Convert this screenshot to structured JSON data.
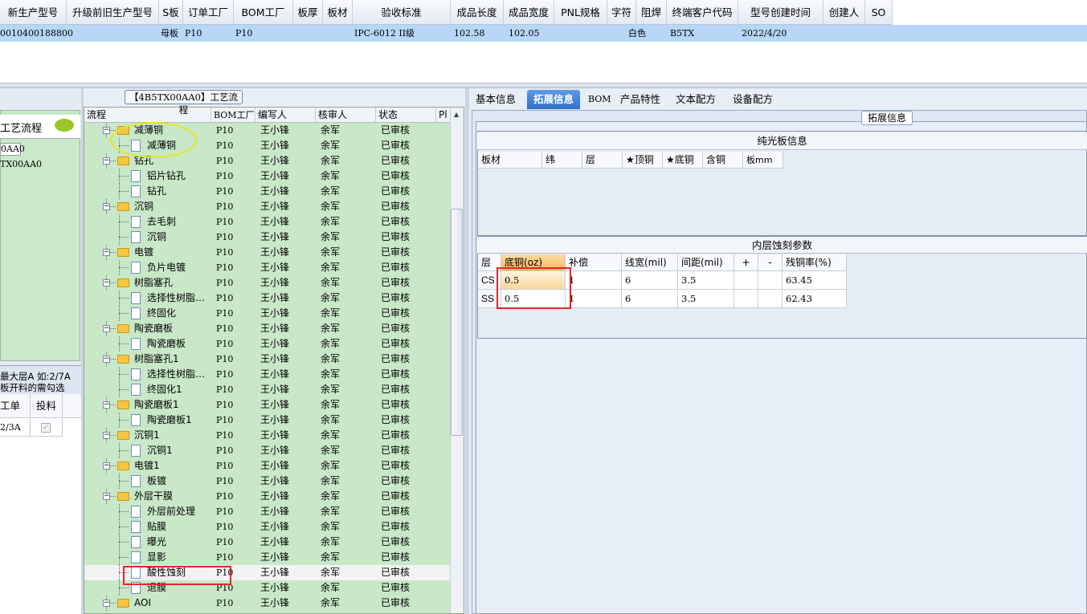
{
  "top_grid": {
    "columns": [
      "新生产型号",
      "升级前旧生产型号",
      "S板",
      "订单工厂",
      "BOM工厂",
      "板厚",
      "板材",
      "验收标准",
      "成品长度",
      "成品宽度",
      "PNL规格",
      "字符",
      "阻焊",
      "终端客户代码",
      "型号创建时间",
      "创建人",
      "SO"
    ],
    "row": {
      "new_model": "0010400188800",
      "s_board": "母板",
      "order_factory": "P10",
      "bom_factory": "P10",
      "standard": "IPC-6012 II级",
      "length": "102.58",
      "width": "102.05",
      "char_color": "白色",
      "customer_code": "B5TX",
      "created": "2022/4/20"
    }
  },
  "left_panel": {
    "title": "工艺流程",
    "item1": "0AA0",
    "item2": "TX00AA0",
    "note1": "最大层A 如:2/7A",
    "note2": "板开料的需勾选",
    "col_workorder": "工单",
    "col_feed": "投料",
    "row_value": "2/3A"
  },
  "middle_panel": {
    "title": "【4B5TX00AA0】工艺流程",
    "headers": [
      "流程",
      "BOM工厂",
      "编写人",
      "核审人",
      "状态",
      "Pl"
    ],
    "rows": [
      {
        "name": "减薄铜",
        "level": 0,
        "factory": "P10",
        "writer": "王小锋",
        "reviewer": "余军",
        "status": "已审核"
      },
      {
        "name": "减薄铜",
        "level": 1,
        "factory": "P10",
        "writer": "王小锋",
        "reviewer": "余军",
        "status": "已审核"
      },
      {
        "name": "钻孔",
        "level": 0,
        "factory": "P10",
        "writer": "王小锋",
        "reviewer": "余军",
        "status": "已审核"
      },
      {
        "name": "铝片钻孔",
        "level": 1,
        "factory": "P10",
        "writer": "王小锋",
        "reviewer": "余军",
        "status": "已审核"
      },
      {
        "name": "钻孔",
        "level": 1,
        "factory": "P10",
        "writer": "王小锋",
        "reviewer": "余军",
        "status": "已审核"
      },
      {
        "name": "沉铜",
        "level": 0,
        "factory": "P10",
        "writer": "王小锋",
        "reviewer": "余军",
        "status": "已审核"
      },
      {
        "name": "去毛刺",
        "level": 1,
        "factory": "P10",
        "writer": "王小锋",
        "reviewer": "余军",
        "status": "已审核"
      },
      {
        "name": "沉铜",
        "level": 1,
        "factory": "P10",
        "writer": "王小锋",
        "reviewer": "余军",
        "status": "已审核"
      },
      {
        "name": "电镀",
        "level": 0,
        "factory": "P10",
        "writer": "王小锋",
        "reviewer": "余军",
        "status": "已审核"
      },
      {
        "name": "负片电镀",
        "level": 1,
        "factory": "P10",
        "writer": "王小锋",
        "reviewer": "余军",
        "status": "已审核"
      },
      {
        "name": "树脂塞孔",
        "level": 0,
        "factory": "P10",
        "writer": "王小锋",
        "reviewer": "余军",
        "status": "已审核"
      },
      {
        "name": "选择性树脂…",
        "level": 1,
        "factory": "P10",
        "writer": "王小锋",
        "reviewer": "余军",
        "status": "已审核"
      },
      {
        "name": "终固化",
        "level": 1,
        "factory": "P10",
        "writer": "王小锋",
        "reviewer": "余军",
        "status": "已审核"
      },
      {
        "name": "陶瓷磨板",
        "level": 0,
        "factory": "P10",
        "writer": "王小锋",
        "reviewer": "余军",
        "status": "已审核"
      },
      {
        "name": "陶瓷磨板",
        "level": 1,
        "factory": "P10",
        "writer": "王小锋",
        "reviewer": "余军",
        "status": "已审核"
      },
      {
        "name": "树脂塞孔1",
        "level": 0,
        "factory": "P10",
        "writer": "王小锋",
        "reviewer": "余军",
        "status": "已审核"
      },
      {
        "name": "选择性树脂…",
        "level": 1,
        "factory": "P10",
        "writer": "王小锋",
        "reviewer": "余军",
        "status": "已审核"
      },
      {
        "name": "终固化1",
        "level": 1,
        "factory": "P10",
        "writer": "王小锋",
        "reviewer": "余军",
        "status": "已审核"
      },
      {
        "name": "陶瓷磨板1",
        "level": 0,
        "factory": "P10",
        "writer": "王小锋",
        "reviewer": "余军",
        "status": "已审核"
      },
      {
        "name": "陶瓷磨板1",
        "level": 1,
        "factory": "P10",
        "writer": "王小锋",
        "reviewer": "余军",
        "status": "已审核"
      },
      {
        "name": "沉铜1",
        "level": 0,
        "factory": "P10",
        "writer": "王小锋",
        "reviewer": "余军",
        "status": "已审核"
      },
      {
        "name": "沉铜1",
        "level": 1,
        "factory": "P10",
        "writer": "王小锋",
        "reviewer": "余军",
        "status": "已审核"
      },
      {
        "name": "电镀1",
        "level": 0,
        "factory": "P10",
        "writer": "王小锋",
        "reviewer": "余军",
        "status": "已审核"
      },
      {
        "name": "板镀",
        "level": 1,
        "factory": "P10",
        "writer": "王小锋",
        "reviewer": "余军",
        "status": "已审核"
      },
      {
        "name": "外层干膜",
        "level": 0,
        "factory": "P10",
        "writer": "王小锋",
        "reviewer": "余军",
        "status": "已审核"
      },
      {
        "name": "外层前处理",
        "level": 1,
        "factory": "P10",
        "writer": "王小锋",
        "reviewer": "余军",
        "status": "已审核"
      },
      {
        "name": "贴膜",
        "level": 1,
        "factory": "P10",
        "writer": "王小锋",
        "reviewer": "余军",
        "status": "已审核"
      },
      {
        "name": "曝光",
        "level": 1,
        "factory": "P10",
        "writer": "王小锋",
        "reviewer": "余军",
        "status": "已审核"
      },
      {
        "name": "显影",
        "level": 1,
        "factory": "P10",
        "writer": "王小锋",
        "reviewer": "余军",
        "status": "已审核"
      },
      {
        "name": "酸性蚀刻",
        "level": 1,
        "factory": "P10",
        "writer": "王小锋",
        "reviewer": "余军",
        "status": "已审核",
        "selected": true
      },
      {
        "name": "退膜",
        "level": 1,
        "factory": "P10",
        "writer": "王小锋",
        "reviewer": "余军",
        "status": "已审核"
      },
      {
        "name": "AOI",
        "level": 0,
        "factory": "P10",
        "writer": "王小锋",
        "reviewer": "余军",
        "status": "已审核"
      }
    ]
  },
  "right_panel": {
    "tabs": [
      "基本信息",
      "拓展信息",
      "BOM",
      "产品特性",
      "文本配方",
      "设备配方"
    ],
    "active_tab": "拓展信息",
    "legend": "拓展信息",
    "box1_title": "纯光板信息",
    "box1_headers": [
      "板材",
      "纬",
      "层",
      "★顶铜",
      "★底铜",
      "含铜",
      "板mm"
    ],
    "box2_title": "内层蚀刻参数",
    "box2_headers": [
      "层",
      "底铜(oz)",
      "补偿",
      "线宽(mil)",
      "间距(mil)",
      "+",
      "-",
      "残铜率(%)"
    ],
    "box2_rows": [
      {
        "layer": "CS",
        "base_copper": "0.5",
        "comp": "1",
        "width": "6",
        "spacing": "3.5",
        "plus": "",
        "minus": "",
        "residual": "63.45"
      },
      {
        "layer": "SS",
        "base_copper": "0.5",
        "comp": "1",
        "width": "6",
        "spacing": "3.5",
        "plus": "",
        "minus": "",
        "residual": "62.43"
      }
    ]
  },
  "colors": {
    "selected_row": "#b8d6f8",
    "tree_bg": "#c8e8c8",
    "active_tab": "#2f6fc8",
    "highlight_red": "#e3262b",
    "ellipse_yellow": "#e6e61e",
    "cell_highlight": "#f9c36a"
  }
}
